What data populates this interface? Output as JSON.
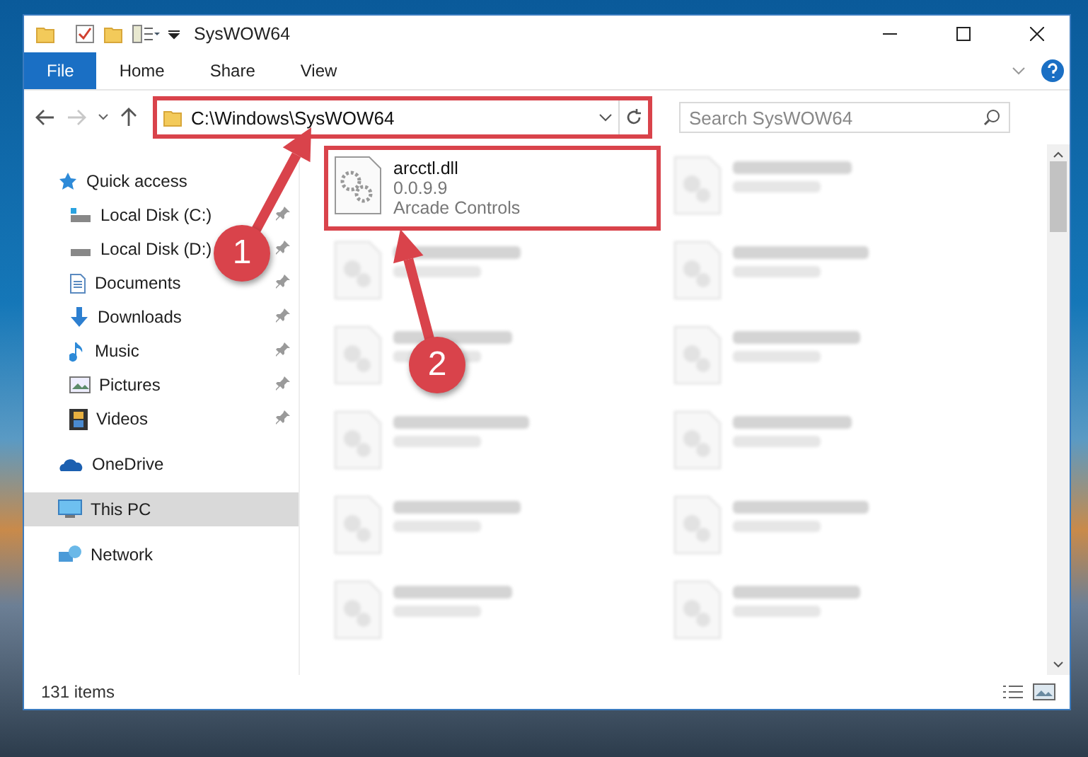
{
  "window": {
    "title": "SysWOW64"
  },
  "ribbon": {
    "tabs": [
      {
        "label": "File",
        "selected": true
      },
      {
        "label": "Home",
        "selected": false
      },
      {
        "label": "Share",
        "selected": false
      },
      {
        "label": "View",
        "selected": false
      }
    ]
  },
  "navigation": {
    "forward_disabled": true,
    "address": {
      "path": "C:\\Windows\\SysWOW64",
      "highlighted": true
    },
    "search": {
      "placeholder": "Search SysWOW64"
    }
  },
  "sidebar": {
    "items": [
      {
        "label": "Quick access",
        "selected": false,
        "children": [
          {
            "label": "Local Disk (C:)",
            "pinned": true,
            "selected": false
          },
          {
            "label": "Local Disk (D:)",
            "pinned": true,
            "selected": false
          },
          {
            "label": "Documents",
            "pinned": true,
            "selected": false
          },
          {
            "label": "Downloads",
            "pinned": true,
            "selected": false
          },
          {
            "label": "Music",
            "pinned": true,
            "selected": false
          },
          {
            "label": "Pictures",
            "pinned": true,
            "selected": false
          },
          {
            "label": "Videos",
            "pinned": true,
            "selected": false
          }
        ]
      },
      {
        "label": "OneDrive",
        "selected": false
      },
      {
        "label": "This PC",
        "selected": true
      },
      {
        "label": "Network",
        "selected": false
      }
    ]
  },
  "files": [
    {
      "name": "arcctl.dll",
      "lines": [
        "0.0.9.9",
        "Arcade Controls"
      ],
      "highlighted": true
    }
  ],
  "status_bar": {
    "count": "131 items"
  },
  "annotations": [
    {
      "label": "1",
      "kind": "address"
    },
    {
      "label": "2",
      "kind": "file"
    }
  ]
}
